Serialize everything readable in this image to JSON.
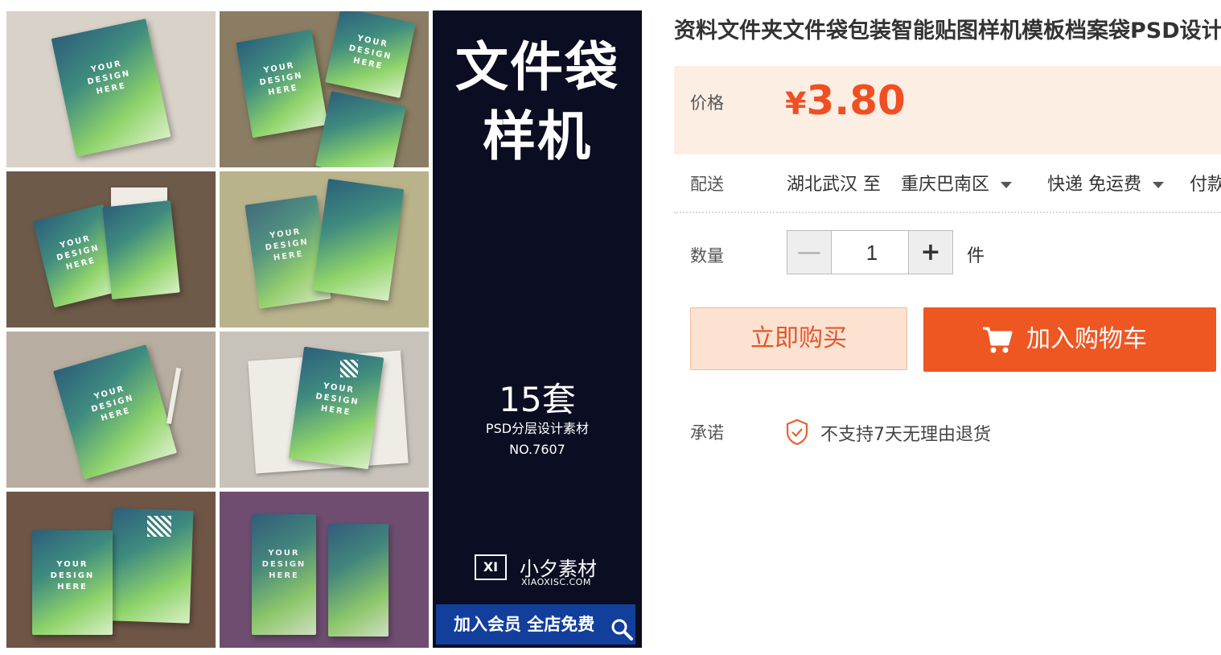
{
  "gallery": {
    "tiles": [
      {
        "text": "YOUR\nDESIGN\nHERE"
      },
      {
        "text": "YOUR\nDESIGN\nHERE"
      },
      {
        "text": "YOUR\nDESIGN\nHERE"
      },
      {
        "text": "YOUR\nDESIGN\nHERE"
      },
      {
        "text": "YOUR\nDESIGN\nHERE"
      },
      {
        "text": "YOUR\nDESIGN\nHERE"
      },
      {
        "text": "YOUR\nDESIGN\nHERE"
      },
      {
        "text": "YOUR\nDESIGN\nHERE"
      }
    ],
    "poster": {
      "line1": "文件袋",
      "line2": "样机",
      "count": "15套",
      "subtitle": "PSD分层设计素材",
      "number": "NO.7607",
      "logo": "XI",
      "brand_name": "小夕素材",
      "brand_url": "XIAOXISC.COM",
      "banner": "加入会员 全店免费"
    }
  },
  "product": {
    "title": "资料文件夹文件袋包装智能贴图样机模板档案袋PSD设计素材",
    "price_label": "价格",
    "currency": "¥",
    "price": "3.80",
    "shipping_label": "配送",
    "ship_from": "湖北武汉 至",
    "ship_to": "重庆巴南区",
    "ship_method": "快递 免运费",
    "payment": "付款后",
    "quantity_label": "数量",
    "quantity": "1",
    "unit": "件",
    "buy_now": "立即购买",
    "add_to_cart": "加入购物车",
    "promise_label": "承诺",
    "promise_text": "不支持7天无理由退货"
  },
  "colors": {
    "accent": "#ee5622",
    "price": "#f04f23",
    "price_bg": "#fdeee4",
    "poster_bg": "#0b0d22",
    "banner_bg": "#123f9c"
  },
  "icons": [
    "minus-icon",
    "plus-icon",
    "cart-icon",
    "shield-check-icon",
    "magnifier-icon",
    "caret-down-icon"
  ]
}
